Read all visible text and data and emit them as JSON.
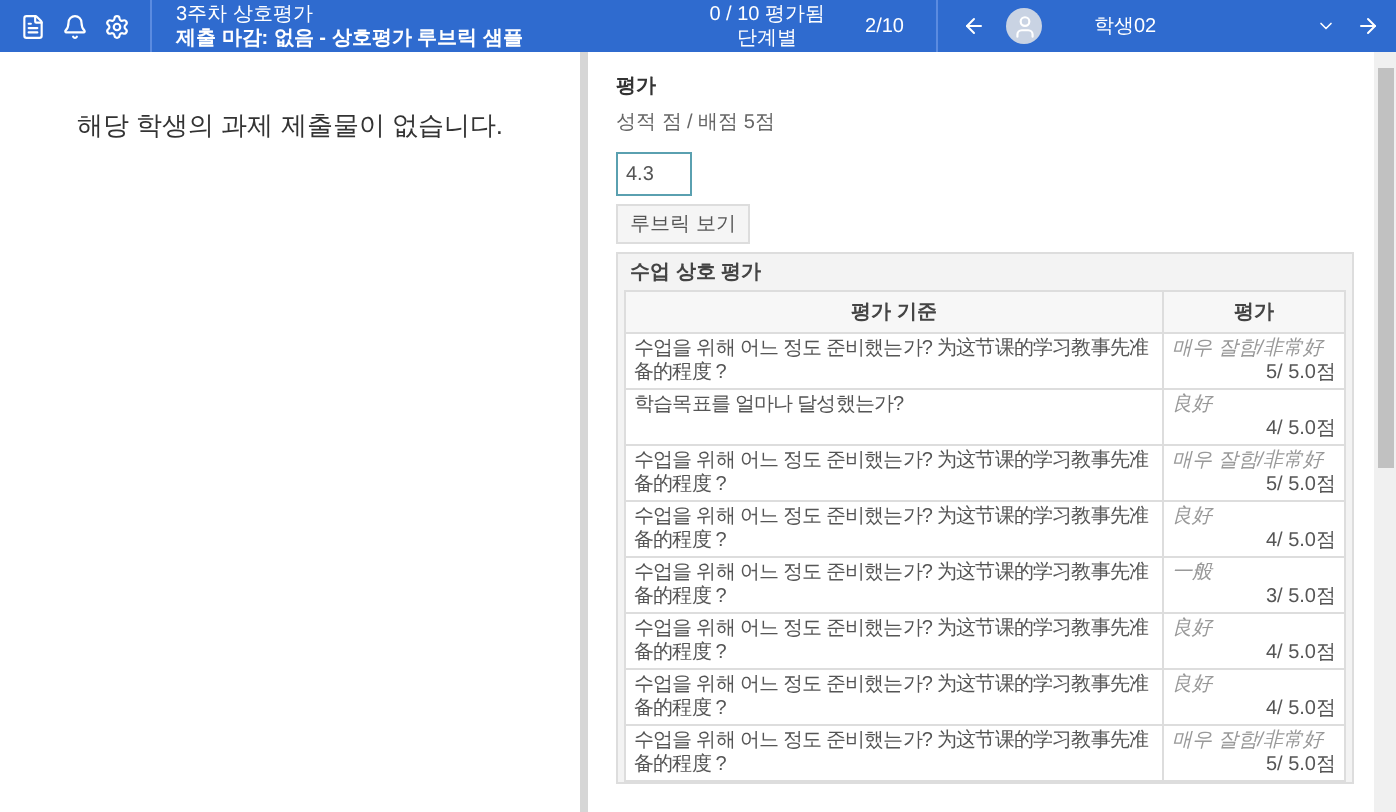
{
  "header": {
    "title": "3주차 상호평가",
    "subtitle": "제출 마감: 없음 - 상호평가 루브릭 샘플",
    "graded": "0 / 10 평가됨",
    "graded_sub": "단계별",
    "position": "2/10",
    "student": "학생02"
  },
  "left": {
    "message": "해당 학생의 과제 제출물이 없습니다."
  },
  "grade": {
    "label": "평가",
    "info": "성적 점 / 배점 5점",
    "value": "4.3",
    "rubric_button": "루브릭 보기"
  },
  "rubric": {
    "title": "수업 상호 평가",
    "columns": [
      "평가 기준",
      "평가"
    ],
    "rows": [
      {
        "criterion": "수업을 위해 어느 정도 준비했는가? 为这节课的学习教事先准备的程度 ?",
        "level": "매우 잘함/非常好",
        "score": "5/ 5.0점"
      },
      {
        "criterion": "학습목표를 얼마나 달성했는가?",
        "level": "良好",
        "score": "4/ 5.0점"
      },
      {
        "criterion": "수업을 위해 어느 정도 준비했는가? 为这节课的学习教事先准备的程度 ?",
        "level": "매우 잘함/非常好",
        "score": "5/ 5.0점"
      },
      {
        "criterion": "수업을 위해 어느 정도 준비했는가? 为这节课的学习教事先准备的程度 ?",
        "level": "良好",
        "score": "4/ 5.0점"
      },
      {
        "criterion": "수업을 위해 어느 정도 준비했는가? 为这节课的学习教事先准备的程度 ?",
        "level": "一般",
        "score": "3/ 5.0점"
      },
      {
        "criterion": "수업을 위해 어느 정도 준비했는가? 为这节课的学习教事先准备的程度 ?",
        "level": "良好",
        "score": "4/ 5.0점"
      },
      {
        "criterion": "수업을 위해 어느 정도 준비했는가? 为这节课的学习教事先准备的程度 ?",
        "level": "良好",
        "score": "4/ 5.0점"
      },
      {
        "criterion": "수업을 위해 어느 정도 준비했는가? 为这节课的学习教事先准备的程度 ?",
        "level": "매우 잘함/非常好",
        "score": "5/ 5.0점"
      }
    ]
  }
}
